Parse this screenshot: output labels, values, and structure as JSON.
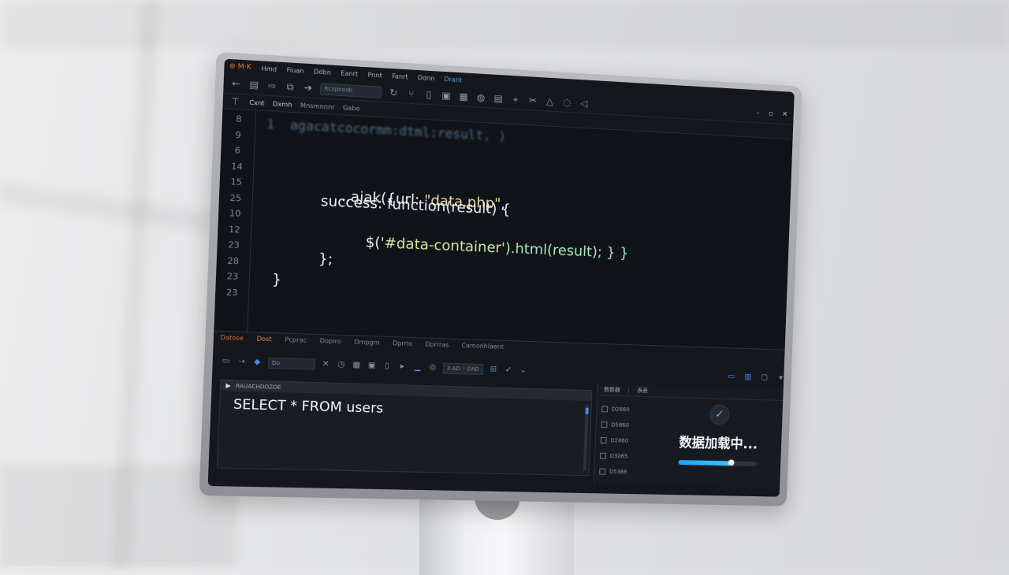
{
  "app": {
    "logo": "⊛ M·K"
  },
  "menu": [
    "Hmd",
    "Fiuan",
    "Ddbn",
    "Eanrt",
    "Pnnt",
    "Fanrt",
    "Ddnn",
    "Drant"
  ],
  "toolbar": {
    "address": "Rcxpnoab"
  },
  "window_controls": {
    "minimize": "–",
    "restore": "▫",
    "close": "✕"
  },
  "tabs": [
    "Cxnt",
    "Dxmh",
    "Mnsmnnnr",
    "Gabe"
  ],
  "line_numbers": [
    "8",
    "9",
    "6",
    "14",
    "15",
    "25",
    "10",
    "12",
    "23",
    "28",
    "23",
    "23"
  ],
  "code": {
    "blurred": "1  agacatcocormm:dtml:result, )",
    "l1_prefix": "..ajak({url: ",
    "l1_str": "\"data.php\"",
    "l1_suffix": ",",
    "l2": "success: function(result) {",
    "l3_a": "$(",
    "l3_sel": "'#data-container'",
    "l3_b": ").html(result); } }",
    "l4": "};",
    "l5": "}"
  },
  "db_tabs": [
    "Datose",
    "Dost",
    "Pcprac",
    "Dopiro",
    "Dmpgm",
    "Dprrio",
    "Dprrras",
    "Camonhlaent"
  ],
  "db_toolbar": {
    "field": "Do",
    "chip": "3 AD ◦ DAD"
  },
  "query": {
    "header": "RAUACHDOZOE",
    "text": "SELECT * FROM users"
  },
  "side": {
    "tabs": [
      "数数器",
      "表表"
    ],
    "items": [
      "D2860",
      "D5860",
      "D2860",
      "D3065",
      "D5386"
    ]
  },
  "loader": {
    "text": "数据加载中...",
    "progress": 0.67
  },
  "colors": {
    "accent": "#3f8fe6",
    "progress": "#1aa3ff",
    "tab_active": "#e08a4d"
  }
}
